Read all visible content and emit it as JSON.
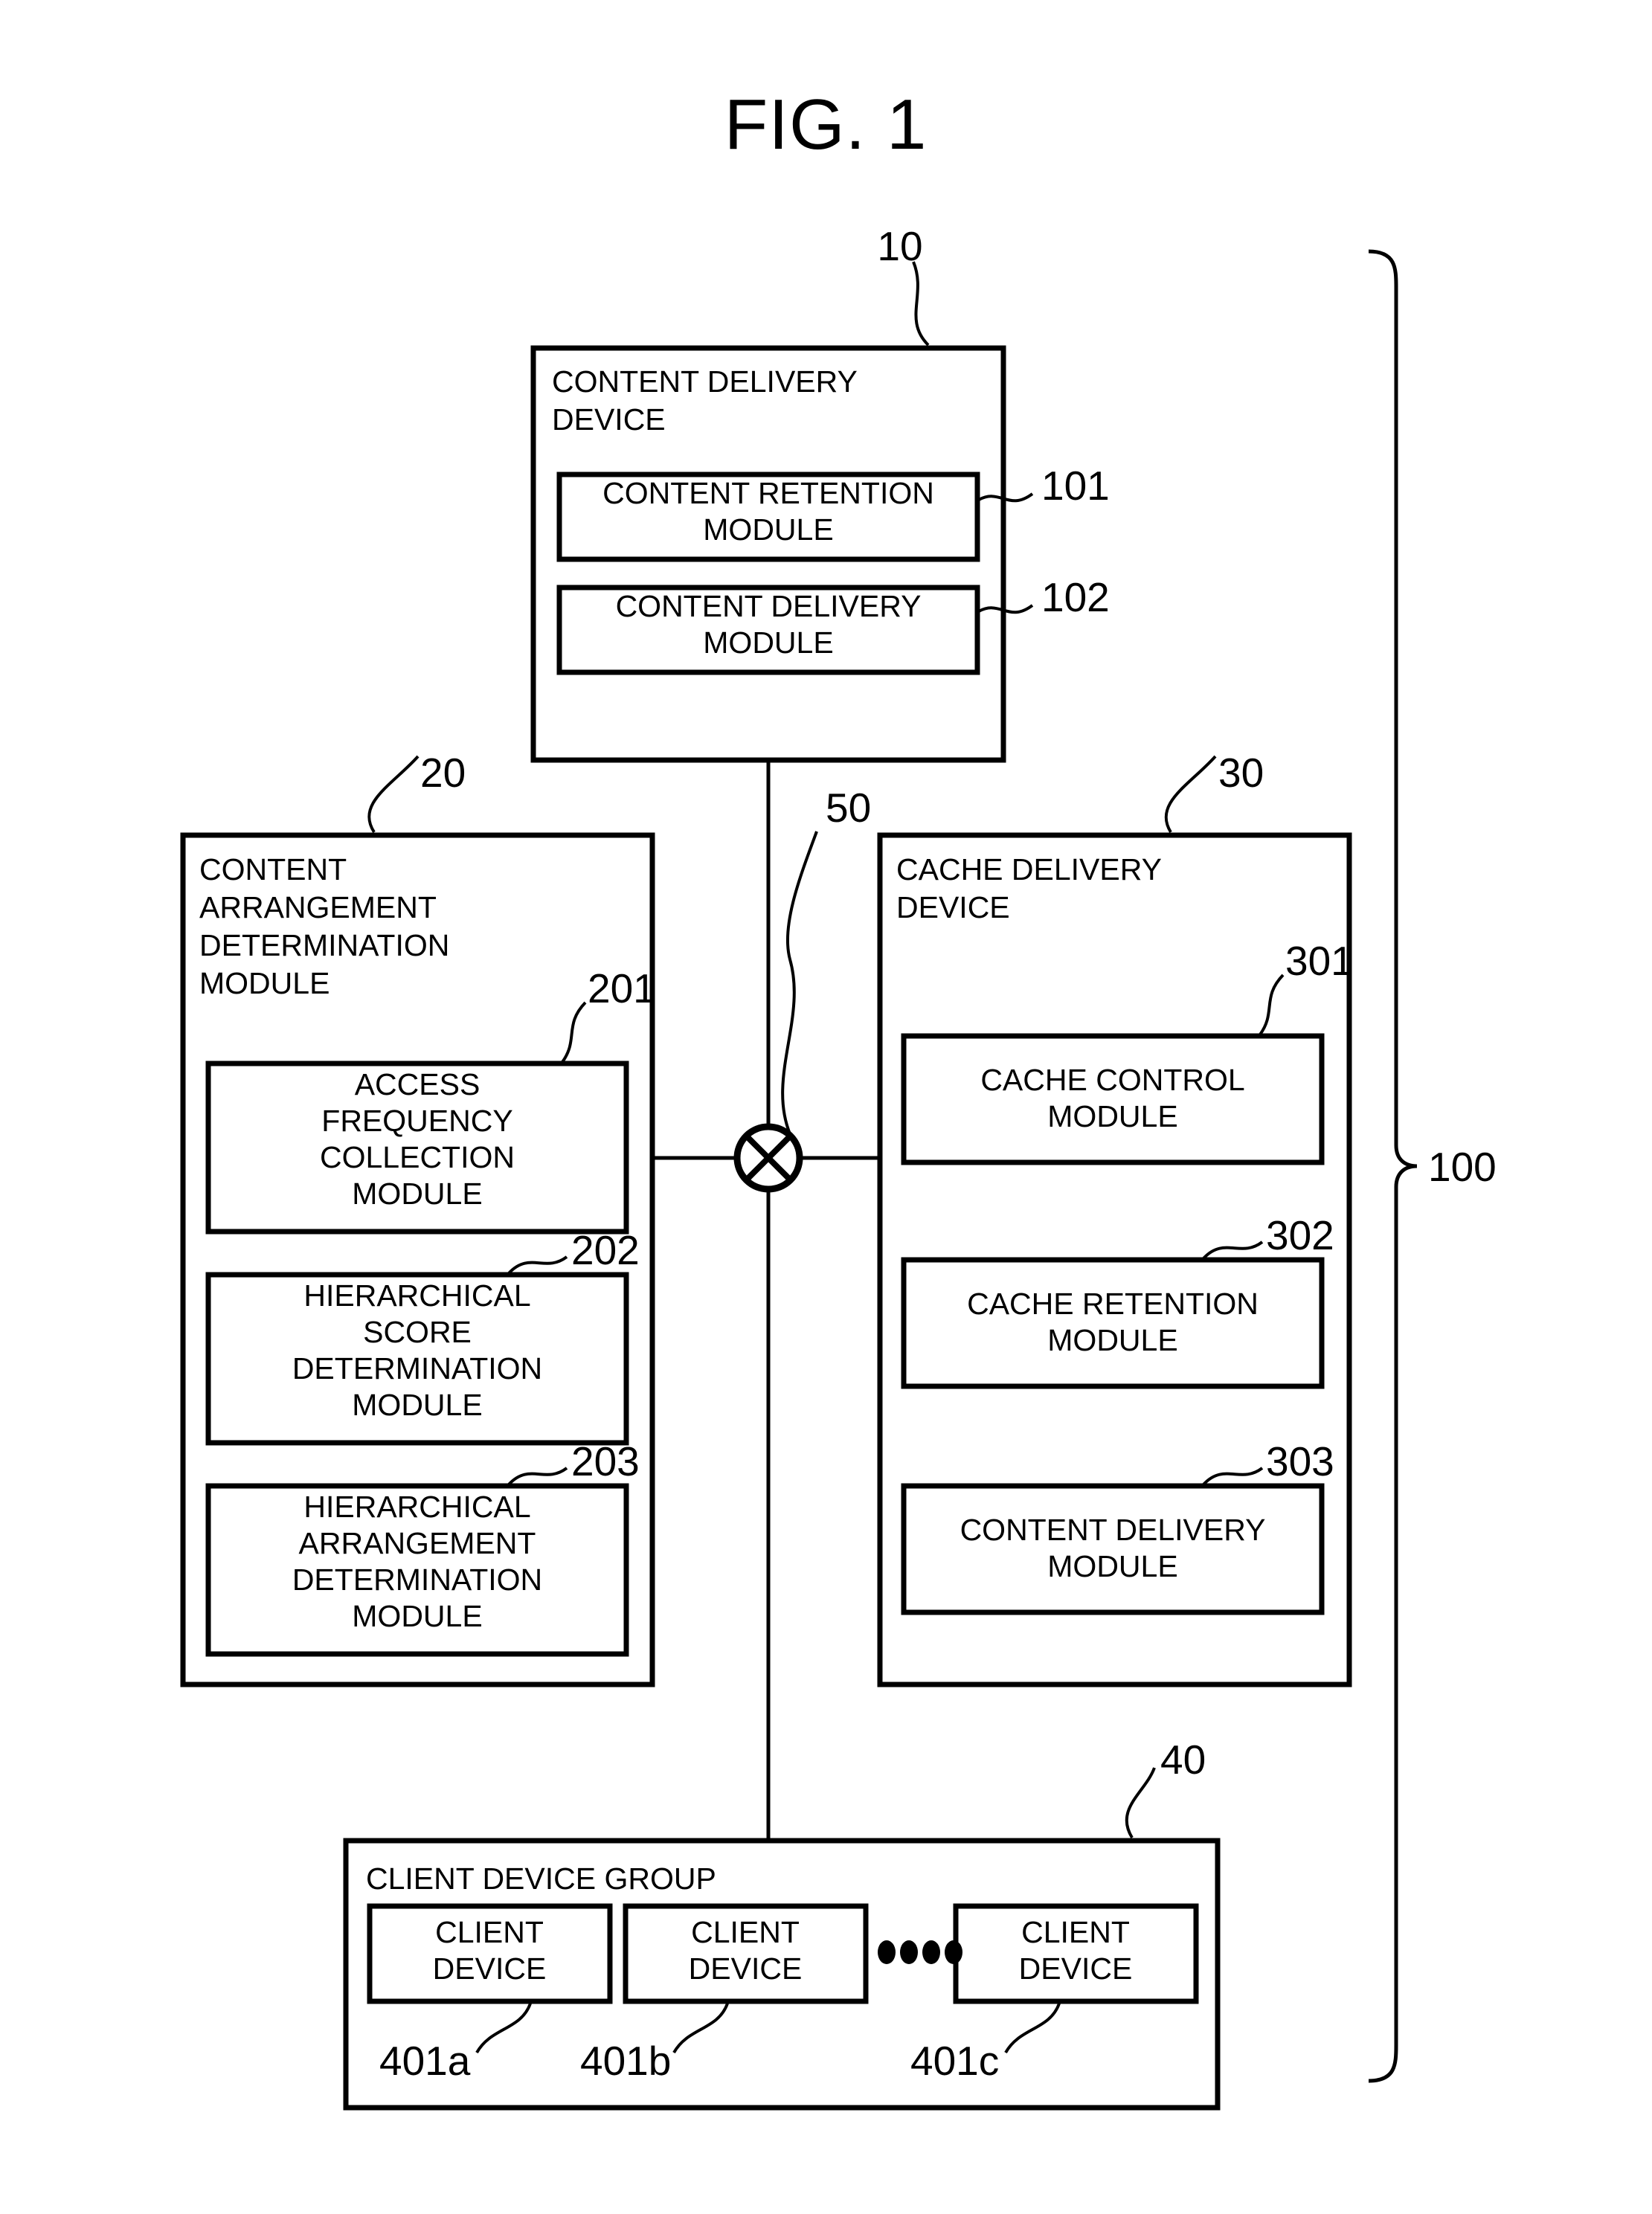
{
  "figure": {
    "title": "FIG. 1",
    "system_ref": "100"
  },
  "content_delivery_device": {
    "ref": "10",
    "title_line1": "CONTENT DELIVERY",
    "title_line2": "DEVICE",
    "modules": [
      {
        "ref": "101",
        "line1": "CONTENT RETENTION",
        "line2": "MODULE"
      },
      {
        "ref": "102",
        "line1": "CONTENT DELIVERY",
        "line2": "MODULE"
      }
    ]
  },
  "content_arrangement_determination_module": {
    "ref": "20",
    "title_line1": "CONTENT",
    "title_line2": "ARRANGEMENT",
    "title_line3": "DETERMINATION",
    "title_line4": "MODULE",
    "modules": [
      {
        "ref": "201",
        "line1": "ACCESS",
        "line2": "FREQUENCY",
        "line3": "COLLECTION",
        "line4": "MODULE"
      },
      {
        "ref": "202",
        "line1": "HIERARCHICAL",
        "line2": "SCORE",
        "line3": "DETERMINATION",
        "line4": "MODULE"
      },
      {
        "ref": "203",
        "line1": "HIERARCHICAL",
        "line2": "ARRANGEMENT",
        "line3": "DETERMINATION",
        "line4": "MODULE"
      }
    ]
  },
  "cache_delivery_device": {
    "ref": "30",
    "title_line1": "CACHE DELIVERY",
    "title_line2": "DEVICE",
    "modules": [
      {
        "ref": "301",
        "line1": "CACHE CONTROL",
        "line2": "MODULE"
      },
      {
        "ref": "302",
        "line1": "CACHE RETENTION",
        "line2": "MODULE"
      },
      {
        "ref": "303",
        "line1": "CONTENT DELIVERY",
        "line2": "MODULE"
      }
    ]
  },
  "client_device_group": {
    "ref": "40",
    "title": "CLIENT DEVICE GROUP",
    "devices": [
      {
        "ref": "401a",
        "line1": "CLIENT",
        "line2": "DEVICE"
      },
      {
        "ref": "401b",
        "line1": "CLIENT",
        "line2": "DEVICE"
      },
      {
        "ref": "401c",
        "line1": "CLIENT",
        "line2": "DEVICE"
      }
    ],
    "ellipsis": "••••"
  },
  "network": {
    "ref": "50",
    "icon": "network-crossed-circle-icon"
  },
  "colors": {
    "stroke": "#000000",
    "background": "#ffffff"
  }
}
